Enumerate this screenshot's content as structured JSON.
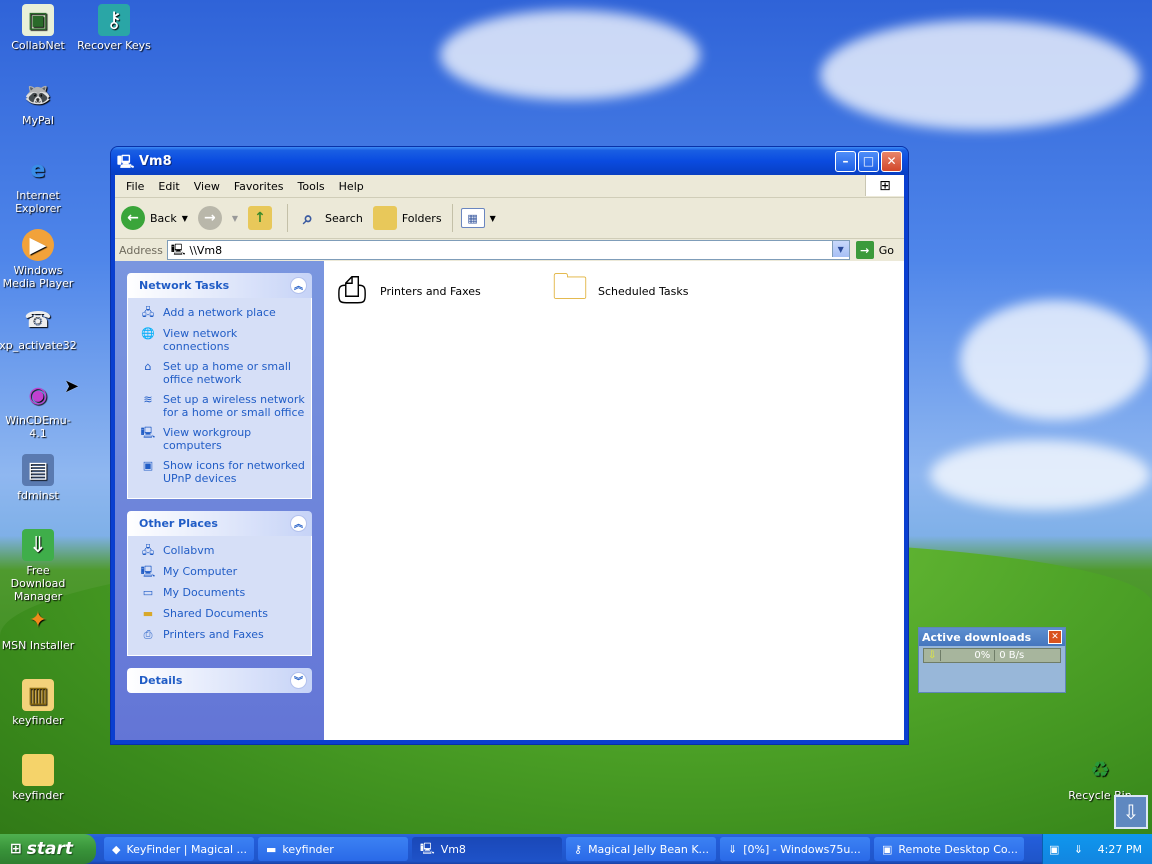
{
  "desktop": {
    "icons": [
      {
        "label": "CollabNet",
        "icon": "certificate-icon"
      },
      {
        "label": "Recover Keys",
        "icon": "key-icon"
      },
      {
        "label": "MyPal",
        "icon": "raccoon-icon"
      },
      {
        "label": "Internet Explorer",
        "icon": "ie-icon"
      },
      {
        "label": "Windows Media Player",
        "icon": "media-player-icon"
      },
      {
        "label": "xp_activate32",
        "icon": "telephone-icon"
      },
      {
        "label": "WinCDEmu-4.1",
        "icon": "disc-icon"
      },
      {
        "label": "fdminst",
        "icon": "installer-icon"
      },
      {
        "label": "Free Download Manager",
        "icon": "download-manager-icon"
      },
      {
        "label": "MSN Installer",
        "icon": "msn-icon"
      },
      {
        "label": "keyfinder",
        "icon": "zip-folder-icon"
      },
      {
        "label": "keyfinder",
        "icon": "folder-icon"
      },
      {
        "label": "Recycle Bin",
        "icon": "recycle-bin-icon"
      }
    ]
  },
  "window": {
    "title": "Vm8",
    "menu": [
      "File",
      "Edit",
      "View",
      "Favorites",
      "Tools",
      "Help"
    ],
    "toolbar": {
      "back": "Back",
      "search": "Search",
      "folders": "Folders"
    },
    "address": {
      "label": "Address",
      "value": "\\\\Vm8",
      "go": "Go"
    },
    "panels": [
      {
        "title": "Network Tasks",
        "items": [
          {
            "label": "Add a network place",
            "icon": "network-place-icon"
          },
          {
            "label": "View network connections",
            "icon": "globe-icon"
          },
          {
            "label": "Set up a home or small office network",
            "icon": "home-network-icon"
          },
          {
            "label": "Set up a wireless network for a home or small office",
            "icon": "wireless-icon"
          },
          {
            "label": "View workgroup computers",
            "icon": "workgroup-icon"
          },
          {
            "label": "Show icons for networked UPnP devices",
            "icon": "upnp-icon"
          }
        ]
      },
      {
        "title": "Other Places",
        "items": [
          {
            "label": "Collabvm",
            "icon": "network-icon"
          },
          {
            "label": "My Computer",
            "icon": "computer-icon"
          },
          {
            "label": "My Documents",
            "icon": "documents-icon"
          },
          {
            "label": "Shared Documents",
            "icon": "folder-icon"
          },
          {
            "label": "Printers and Faxes",
            "icon": "printer-icon"
          }
        ]
      },
      {
        "title": "Details",
        "items": []
      }
    ],
    "items": [
      {
        "label": "Printers and Faxes",
        "icon": "printer-folder-icon"
      },
      {
        "label": "Scheduled Tasks",
        "icon": "scheduled-tasks-icon"
      }
    ]
  },
  "active_downloads": {
    "title": "Active downloads",
    "percent": "0%",
    "speed": "0 B/s"
  },
  "taskbar": {
    "start": "start",
    "tasks": [
      {
        "label": "KeyFinder | Magical ...",
        "active": false
      },
      {
        "label": "keyfinder",
        "active": false
      },
      {
        "label": "Vm8",
        "active": true
      },
      {
        "label": "Magical Jelly Bean K...",
        "active": false
      },
      {
        "label": "[0%] - Windows75u...",
        "active": false
      },
      {
        "label": "Remote Desktop Co...",
        "active": false
      }
    ],
    "clock": "4:27 PM"
  },
  "colors": {
    "accent": "#215dc6",
    "titlebar": "#0a4be0",
    "start": "#39943a"
  }
}
